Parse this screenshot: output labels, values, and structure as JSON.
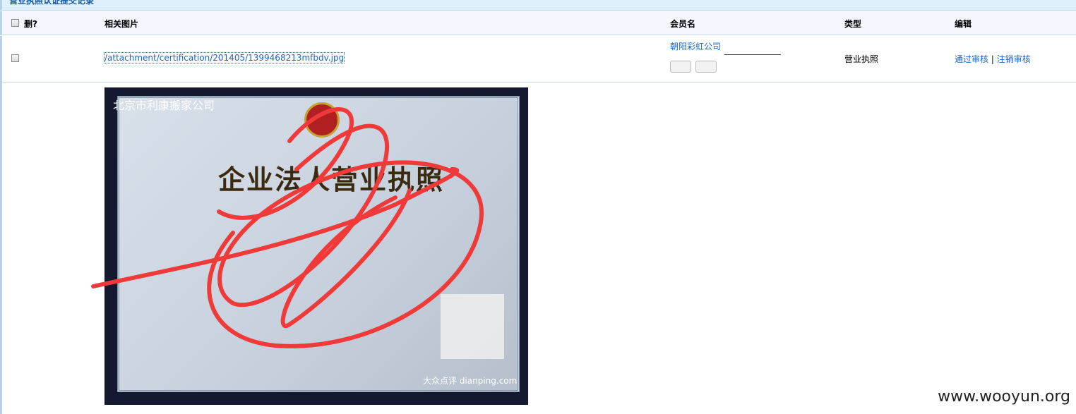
{
  "panel": {
    "title": "营业执照认证提交记录"
  },
  "table": {
    "headers": {
      "delete": "删?",
      "image": "相关图片",
      "member": "会员名",
      "type": "类型",
      "edit": "编辑"
    },
    "rows": [
      {
        "file": "/attachment/certification/201405/1399468213mfbdv.jpg",
        "member": "朝阳彩虹公司",
        "type": "营业执照",
        "approve": "通过审核",
        "separator": "|",
        "revoke": "注销审核"
      }
    ]
  },
  "photo": {
    "watermark": "北京市利康搬家公司",
    "doc_title": "企业法人营业执照",
    "logo": "大众点评 dianping.com"
  },
  "watermark_site": "www.wooyun.org",
  "colors": {
    "link": "#1a64c8",
    "scribble": "#f03a3a",
    "header_bg": "#f4f8fe"
  }
}
